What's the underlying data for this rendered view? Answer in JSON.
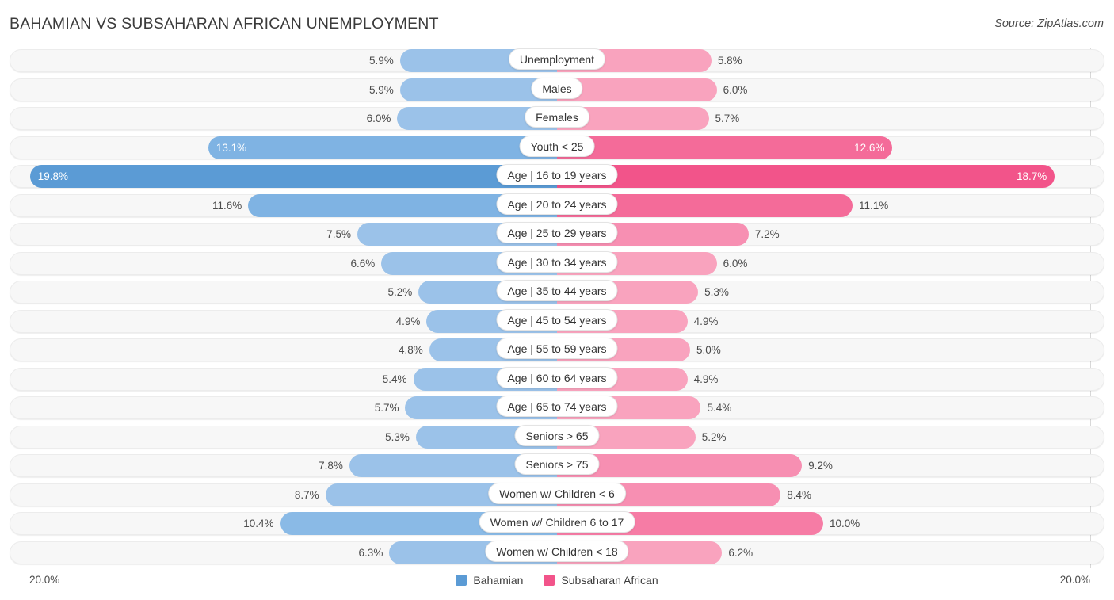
{
  "header": {
    "title": "BAHAMIAN VS SUBSAHARAN AFRICAN UNEMPLOYMENT",
    "source": "Source: ZipAtlas.com"
  },
  "axis": {
    "left_label": "20.0%",
    "right_label": "20.0%",
    "max": 20.0
  },
  "legend": [
    {
      "label": "Bahamian",
      "color": "#5B9BD5"
    },
    {
      "label": "Subsaharan African",
      "color": "#F2548A"
    }
  ],
  "colors": {
    "blue_light": "#9BC2E9",
    "blue_mid": "#7FB3E3",
    "blue_deep": "#5B9BD5",
    "pink_light": "#F9A3BE",
    "pink_mid": "#F589AC",
    "pink_deep": "#F25D8E",
    "track": "#F7F7F7",
    "gridline": "#D8D8D8"
  },
  "chart_data": {
    "type": "bar",
    "title": "BAHAMIAN VS SUBSAHARAN AFRICAN UNEMPLOYMENT",
    "subtitle": "",
    "xlabel": "",
    "ylabel": "",
    "orientation": "horizontal-diverging",
    "unit": "%",
    "xlim": [
      0,
      20
    ],
    "grid": false,
    "legend_position": "bottom-center",
    "categories": [
      "Unemployment",
      "Males",
      "Females",
      "Youth < 25",
      "Age | 16 to 19 years",
      "Age | 20 to 24 years",
      "Age | 25 to 29 years",
      "Age | 30 to 34 years",
      "Age | 35 to 44 years",
      "Age | 45 to 54 years",
      "Age | 55 to 59 years",
      "Age | 60 to 64 years",
      "Age | 65 to 74 years",
      "Seniors > 65",
      "Seniors > 75",
      "Women w/ Children < 6",
      "Women w/ Children 6 to 17",
      "Women w/ Children < 18"
    ],
    "series": [
      {
        "name": "Bahamian",
        "color": "#5B9BD5",
        "values": [
          5.9,
          5.9,
          6.0,
          13.1,
          19.8,
          11.6,
          7.5,
          6.6,
          5.2,
          4.9,
          4.8,
          5.4,
          5.7,
          5.3,
          7.8,
          8.7,
          10.4,
          6.3
        ]
      },
      {
        "name": "Subsaharan African",
        "color": "#F2548A",
        "values": [
          5.8,
          6.0,
          5.7,
          12.6,
          18.7,
          11.1,
          7.2,
          6.0,
          5.3,
          4.9,
          5.0,
          4.9,
          5.4,
          5.2,
          9.2,
          8.4,
          10.0,
          6.2
        ]
      }
    ]
  },
  "rows": [
    {
      "label": "Unemployment",
      "left": "5.9%",
      "right": "5.8%",
      "lv": 5.9,
      "rv": 5.8,
      "lc": "#9BC2E9",
      "rc": "#F9A3BE",
      "lin": false,
      "rin": false
    },
    {
      "label": "Males",
      "left": "5.9%",
      "right": "6.0%",
      "lv": 5.9,
      "rv": 6.0,
      "lc": "#9BC2E9",
      "rc": "#F9A3BE",
      "lin": false,
      "rin": false
    },
    {
      "label": "Females",
      "left": "6.0%",
      "right": "5.7%",
      "lv": 6.0,
      "rv": 5.7,
      "lc": "#9BC2E9",
      "rc": "#F9A3BE",
      "lin": false,
      "rin": false
    },
    {
      "label": "Youth < 25",
      "left": "13.1%",
      "right": "12.6%",
      "lv": 13.1,
      "rv": 12.6,
      "lc": "#7FB3E3",
      "rc": "#F46B99",
      "lin": true,
      "rin": true
    },
    {
      "label": "Age | 16 to 19 years",
      "left": "19.8%",
      "right": "18.7%",
      "lv": 19.8,
      "rv": 18.7,
      "lc": "#5B9BD5",
      "rc": "#F2548A",
      "lin": true,
      "rin": true
    },
    {
      "label": "Age | 20 to 24 years",
      "left": "11.6%",
      "right": "11.1%",
      "lv": 11.6,
      "rv": 11.1,
      "lc": "#7FB3E3",
      "rc": "#F46B99",
      "lin": false,
      "rin": false
    },
    {
      "label": "Age | 25 to 29 years",
      "left": "7.5%",
      "right": "7.2%",
      "lv": 7.5,
      "rv": 7.2,
      "lc": "#9BC2E9",
      "rc": "#F78FB2",
      "lin": false,
      "rin": false
    },
    {
      "label": "Age | 30 to 34 years",
      "left": "6.6%",
      "right": "6.0%",
      "lv": 6.6,
      "rv": 6.0,
      "lc": "#9BC2E9",
      "rc": "#F9A3BE",
      "lin": false,
      "rin": false
    },
    {
      "label": "Age | 35 to 44 years",
      "left": "5.2%",
      "right": "5.3%",
      "lv": 5.2,
      "rv": 5.3,
      "lc": "#9BC2E9",
      "rc": "#F9A3BE",
      "lin": false,
      "rin": false
    },
    {
      "label": "Age | 45 to 54 years",
      "left": "4.9%",
      "right": "4.9%",
      "lv": 4.9,
      "rv": 4.9,
      "lc": "#9BC2E9",
      "rc": "#F9A3BE",
      "lin": false,
      "rin": false
    },
    {
      "label": "Age | 55 to 59 years",
      "left": "4.8%",
      "right": "5.0%",
      "lv": 4.8,
      "rv": 5.0,
      "lc": "#9BC2E9",
      "rc": "#F9A3BE",
      "lin": false,
      "rin": false
    },
    {
      "label": "Age | 60 to 64 years",
      "left": "5.4%",
      "right": "4.9%",
      "lv": 5.4,
      "rv": 4.9,
      "lc": "#9BC2E9",
      "rc": "#F9A3BE",
      "lin": false,
      "rin": false
    },
    {
      "label": "Age | 65 to 74 years",
      "left": "5.7%",
      "right": "5.4%",
      "lv": 5.7,
      "rv": 5.4,
      "lc": "#9BC2E9",
      "rc": "#F9A3BE",
      "lin": false,
      "rin": false
    },
    {
      "label": "Seniors > 65",
      "left": "5.3%",
      "right": "5.2%",
      "lv": 5.3,
      "rv": 5.2,
      "lc": "#9BC2E9",
      "rc": "#F9A3BE",
      "lin": false,
      "rin": false
    },
    {
      "label": "Seniors > 75",
      "left": "7.8%",
      "right": "9.2%",
      "lv": 7.8,
      "rv": 9.2,
      "lc": "#9BC2E9",
      "rc": "#F78FB2",
      "lin": false,
      "rin": false
    },
    {
      "label": "Women w/ Children < 6",
      "left": "8.7%",
      "right": "8.4%",
      "lv": 8.7,
      "rv": 8.4,
      "lc": "#9BC2E9",
      "rc": "#F78FB2",
      "lin": false,
      "rin": false
    },
    {
      "label": "Women w/ Children 6 to 17",
      "left": "10.4%",
      "right": "10.0%",
      "lv": 10.4,
      "rv": 10.0,
      "lc": "#8ABAE6",
      "rc": "#F67CA5",
      "lin": false,
      "rin": false
    },
    {
      "label": "Women w/ Children < 18",
      "left": "6.3%",
      "right": "6.2%",
      "lv": 6.3,
      "rv": 6.2,
      "lc": "#9BC2E9",
      "rc": "#F9A3BE",
      "lin": false,
      "rin": false
    }
  ]
}
